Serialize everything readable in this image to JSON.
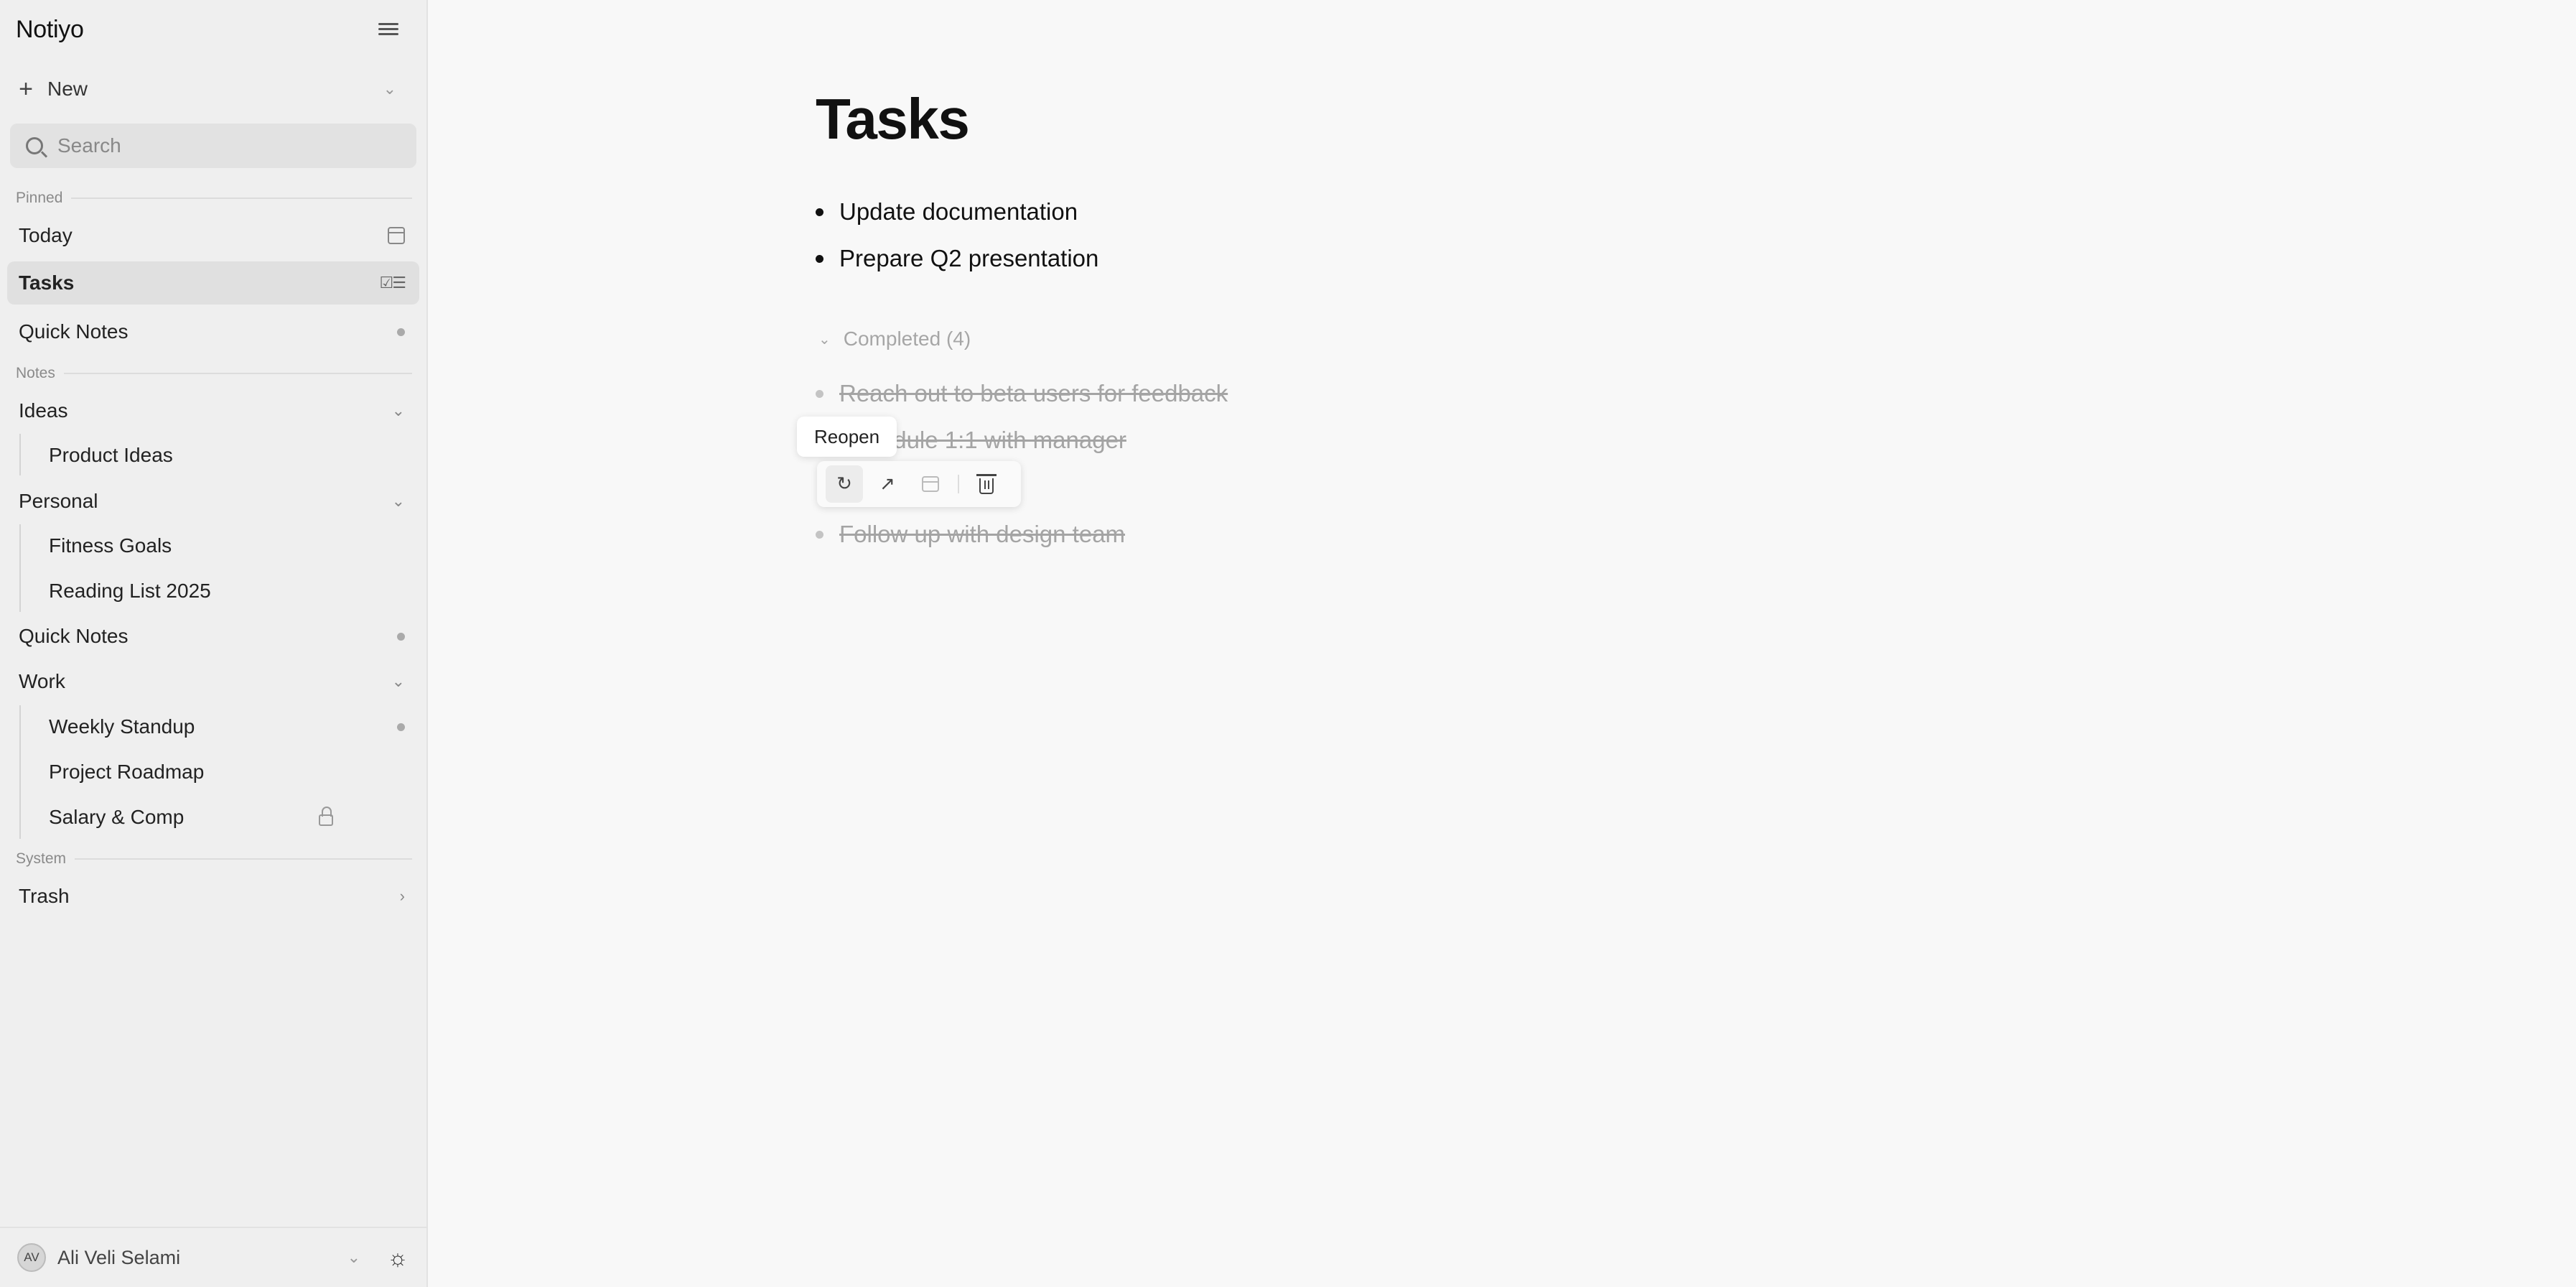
{
  "app": {
    "name": "Notiyo"
  },
  "sidebar": {
    "new_label": "New",
    "search_placeholder": "Search",
    "sections": {
      "pinned": "Pinned",
      "notes": "Notes",
      "system": "System"
    },
    "pinned": [
      {
        "label": "Today",
        "icon": "calendar-icon"
      },
      {
        "label": "Tasks",
        "icon": "tasks-list-icon",
        "active": true
      },
      {
        "label": "Quick Notes",
        "icon": "dot-indicator"
      }
    ],
    "notes": {
      "ideas": {
        "label": "Ideas",
        "children": [
          "Product Ideas"
        ]
      },
      "personal": {
        "label": "Personal",
        "children": [
          "Fitness Goals",
          "Reading List 2025"
        ]
      },
      "quick_notes": "Quick Notes",
      "work": {
        "label": "Work",
        "children": [
          "Weekly Standup",
          "Project Roadmap",
          "Salary & Comp"
        ]
      }
    },
    "system": {
      "trash": "Trash"
    },
    "user": {
      "initials": "AV",
      "name": "Ali Veli Selami"
    }
  },
  "main": {
    "title": "Tasks",
    "open_tasks": [
      "Update documentation",
      "Prepare Q2 presentation"
    ],
    "completed_label": "Completed (4)",
    "completed_tasks": [
      "Reach out to beta users for feedback",
      "Schedule 1:1 with manager",
      "Follow up with design team"
    ],
    "tooltip": "Reopen",
    "toolbar_icons": [
      "reopen-icon",
      "open-icon",
      "calendar-icon",
      "trash-icon"
    ]
  }
}
